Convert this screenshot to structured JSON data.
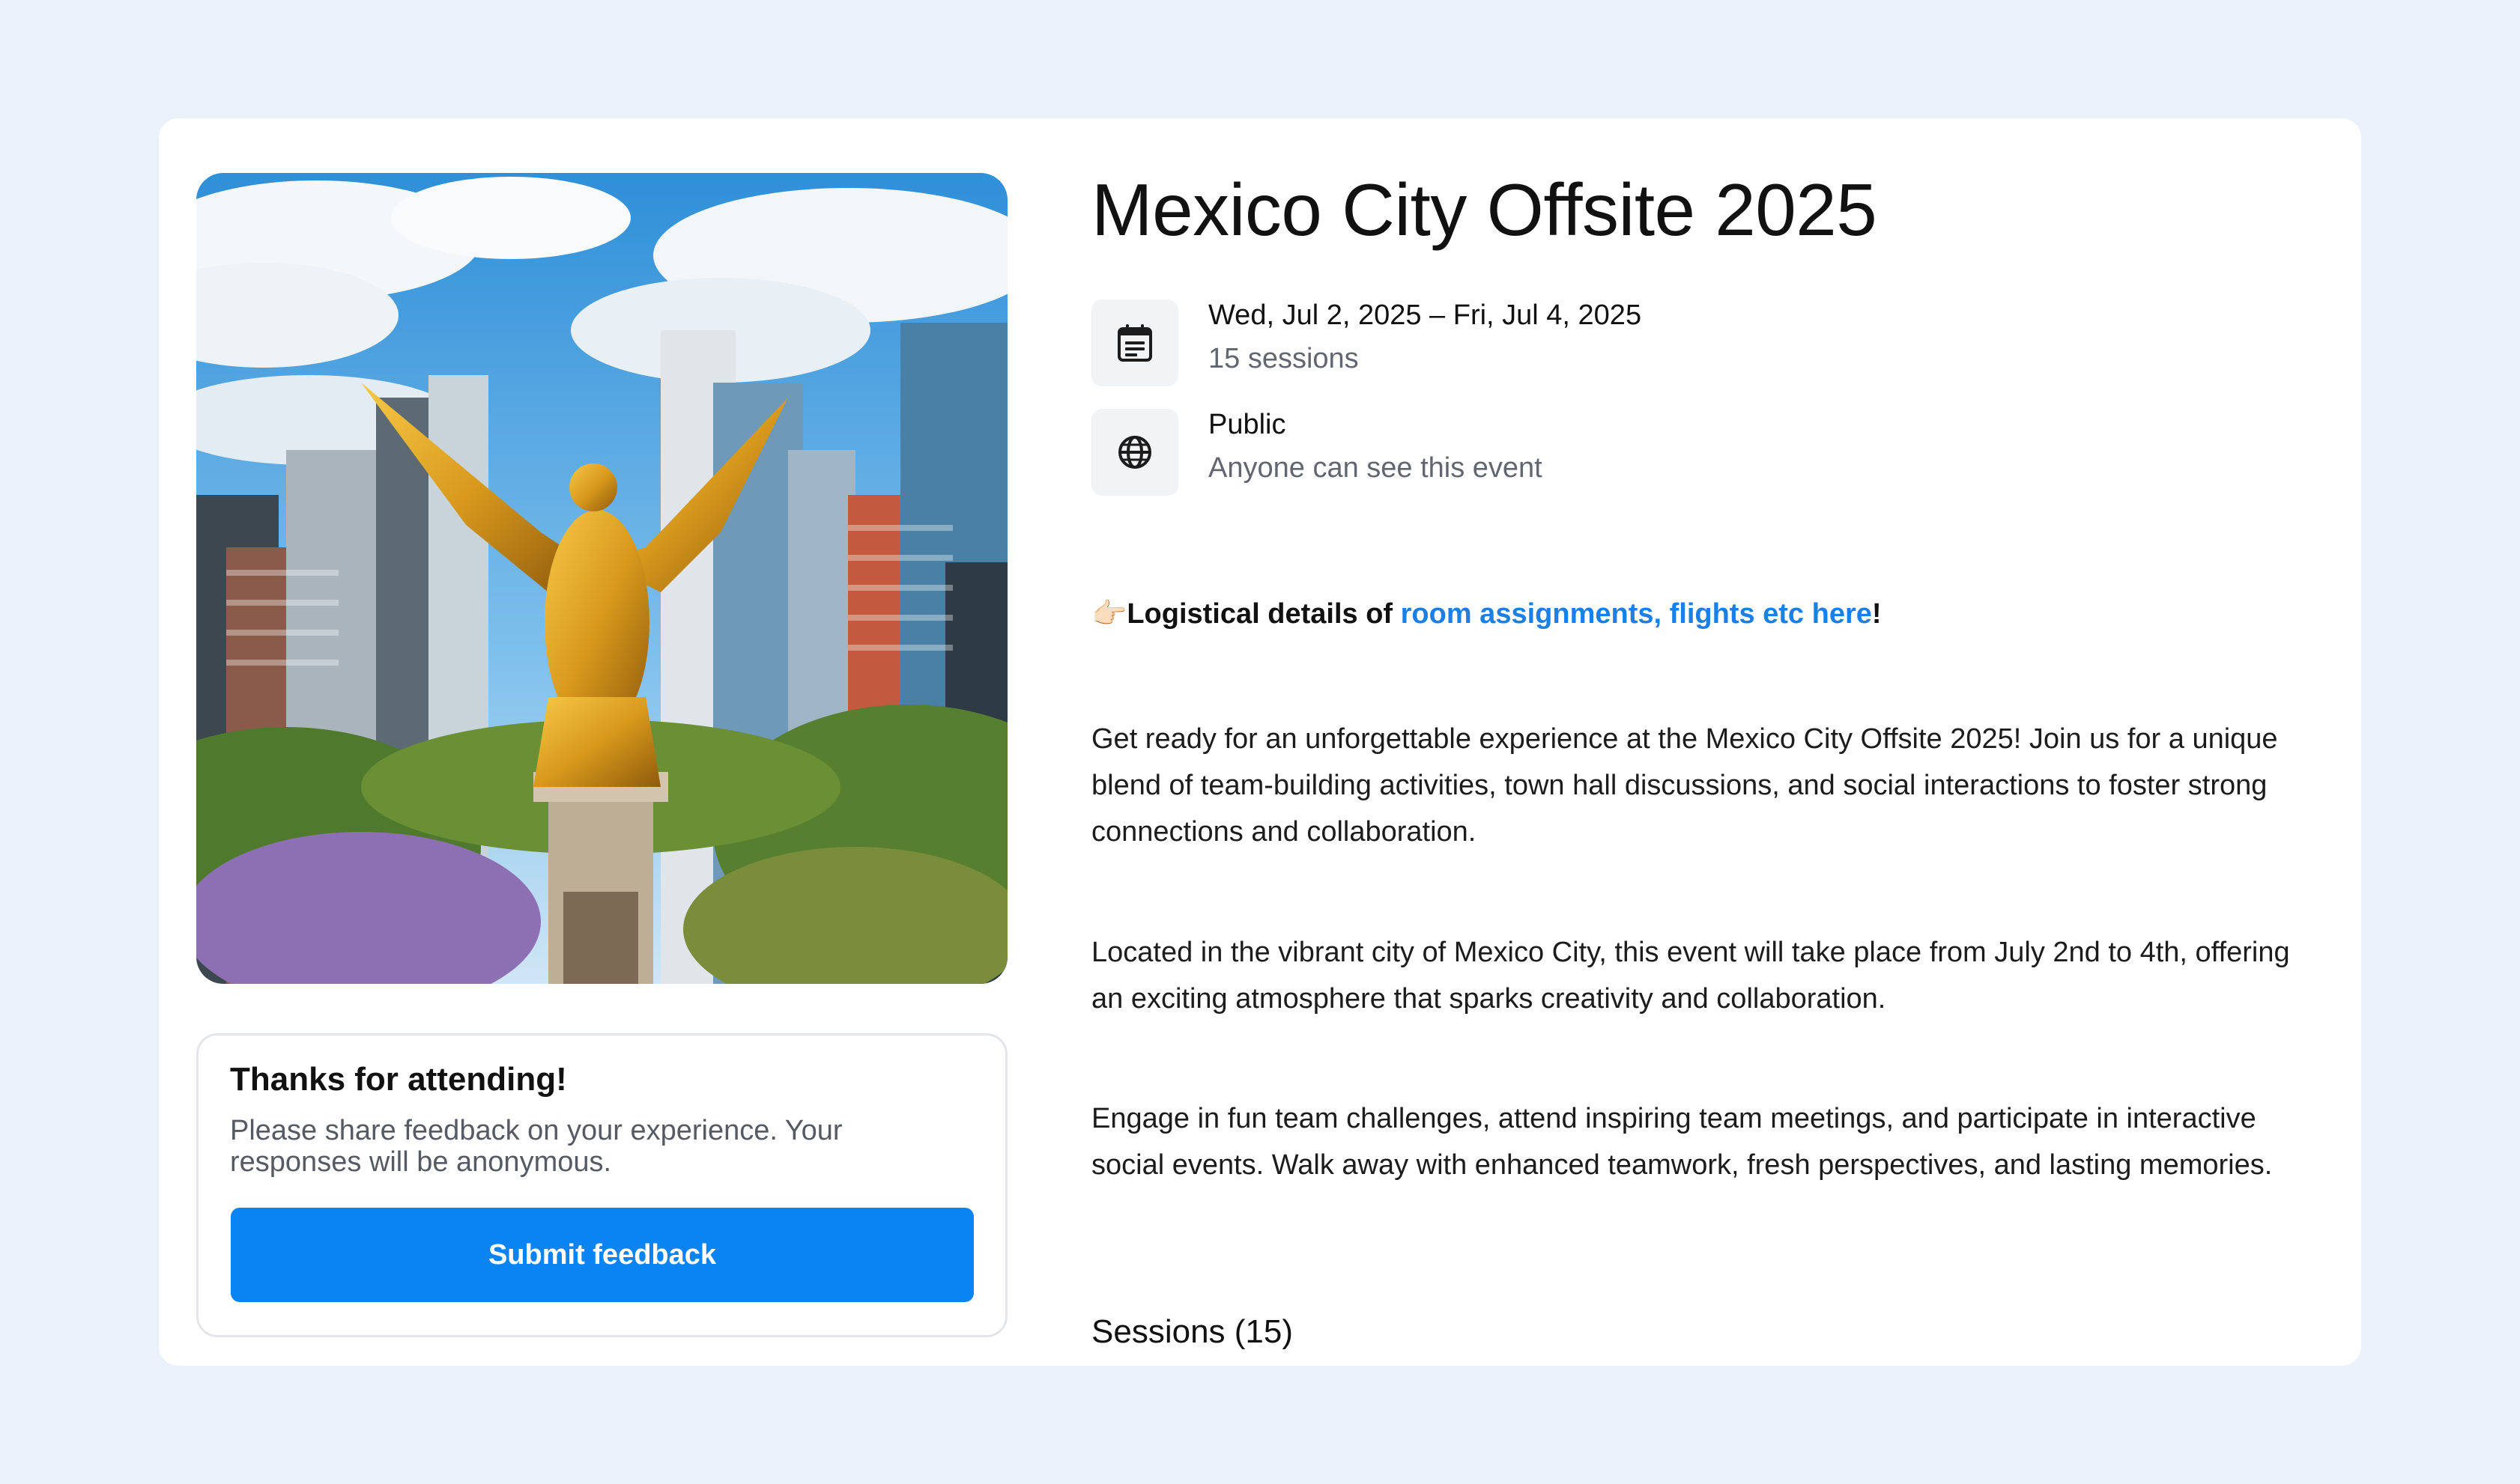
{
  "event": {
    "title": "Mexico City Offsite 2025",
    "date_range": "Wed, Jul 2, 2025 – Fri, Jul 4, 2025",
    "sessions_count_text": "15 sessions",
    "visibility": "Public",
    "visibility_description": "Anyone can see this event"
  },
  "logistics": {
    "emoji": "👉🏻",
    "prefix": "Logistical details of ",
    "link_text": "room assignments, flights etc here",
    "suffix": "!"
  },
  "description": [
    "Get ready for an unforgettable experience at the Mexico City Offsite 2025! Join us for a unique blend of team-building activities, town hall discussions, and social interactions to foster strong connections and collaboration.",
    "Located in the vibrant city of Mexico City, this event will take place from July 2nd to 4th, offering an exciting atmosphere that sparks creativity and collaboration.",
    "Engage in fun team challenges, attend inspiring team meetings, and participate in interactive social events. Walk away with enhanced teamwork, fresh perspectives, and lasting memories."
  ],
  "sessions_heading": "Sessions (15)",
  "feedback": {
    "title": "Thanks for attending!",
    "text": "Please share feedback on your experience. Your responses will be anonymous.",
    "button_label": "Submit feedback"
  },
  "icons": {
    "date": "calendar-icon",
    "visibility": "globe-icon"
  },
  "colors": {
    "page_background": "#eaf1fa",
    "accent": "#0b84f3",
    "link": "#1a7fe6"
  }
}
